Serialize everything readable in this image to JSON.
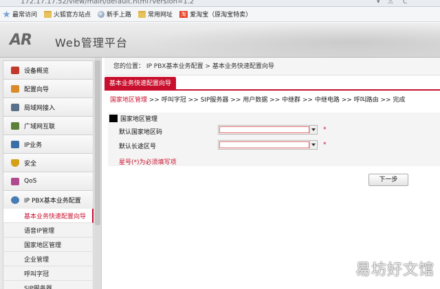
{
  "browser": {
    "url": "172.17.17.52/view/main/default.html?version=1.2",
    "bookmarks": [
      {
        "label": "最常访问",
        "icon": "bookmark-star-icon"
      },
      {
        "label": "火狐官方站点",
        "icon": "folder-icon"
      },
      {
        "label": "新手上路",
        "icon": "globe-icon"
      },
      {
        "label": "常用网址",
        "icon": "folder-icon"
      },
      {
        "label": "爱淘宝（原淘宝特卖）",
        "icon": "taobao-icon"
      }
    ],
    "taobao_glyph": "淘"
  },
  "header": {
    "logo": "AR",
    "title": "Web管理平台"
  },
  "sidebar": {
    "items": [
      {
        "label": "设备概览",
        "icon": "overview-icon",
        "color": "#c0392b"
      },
      {
        "label": "配置向导",
        "icon": "wizard-icon",
        "color": "#d98b2b"
      },
      {
        "label": "局域网接入",
        "icon": "lan-icon",
        "color": "#5a6f8a"
      },
      {
        "label": "广域网互联",
        "icon": "wan-icon",
        "color": "#5c7f3a"
      },
      {
        "label": "IP业务",
        "icon": "ip-service-icon",
        "color": "#3a6ea5"
      },
      {
        "label": "安全",
        "icon": "shield-icon",
        "color": "#d4a017"
      },
      {
        "label": "QoS",
        "icon": "qos-icon",
        "color": "#b04a8f"
      },
      {
        "label": "IP PBX基本业务配置",
        "icon": "pbx-icon",
        "color": "#4a7bb5"
      }
    ],
    "subitems": [
      {
        "label": "基本业务快速配置向导",
        "active": true
      },
      {
        "label": "语音IP管理",
        "active": false
      },
      {
        "label": "国家地区管理",
        "active": false
      },
      {
        "label": "企业管理",
        "active": false
      },
      {
        "label": "呼叫字冠",
        "active": false
      },
      {
        "label": "SIP服务器",
        "active": false
      }
    ]
  },
  "main": {
    "breadcrumb": "您的位置： IP PBX基本业务配置 > 基本业务快速配置向导",
    "tab": "基本业务快速配置向导",
    "steps_current": "国家地区管理",
    "steps_rest": " >> 呼叫字冠 >> SIP服务器 >> 用户数据 >> 中继群 >> 中继电路 >> 呼叫路由 >> 完成",
    "panel_title": "国家地区管理",
    "fields": [
      {
        "label": "默认国家地区码",
        "value": "",
        "required_mark": "*"
      },
      {
        "label": "默认长途区号",
        "value": "",
        "required_mark": "*"
      }
    ],
    "note": "星号(*)为必须填写项",
    "next_button": "下一步"
  },
  "watermark": "易坊好文馆",
  "colors": {
    "accent": "#c8102e"
  }
}
